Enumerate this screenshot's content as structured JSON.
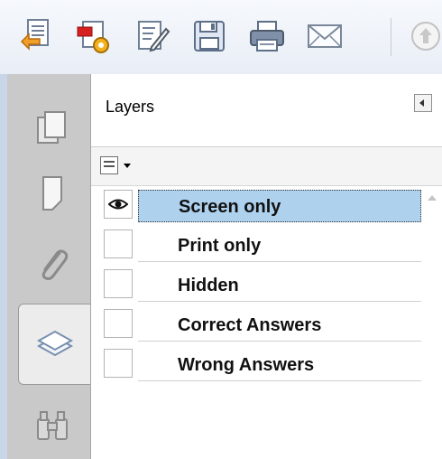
{
  "toolbar": {
    "buttons": [
      {
        "icon": "create-pdf-icon"
      },
      {
        "icon": "settings-document-icon"
      },
      {
        "icon": "edit-document-icon"
      },
      {
        "icon": "save-icon"
      },
      {
        "icon": "print-icon"
      },
      {
        "icon": "email-icon"
      },
      {
        "icon": "upload-icon"
      }
    ]
  },
  "nav_rail": {
    "items": [
      {
        "icon": "pages-icon",
        "active": false
      },
      {
        "icon": "bookmark-icon",
        "active": false
      },
      {
        "icon": "attachment-icon",
        "active": false
      },
      {
        "icon": "layers-icon",
        "active": true
      },
      {
        "icon": "binoculars-icon",
        "active": false
      }
    ]
  },
  "layers_panel": {
    "title": "Layers",
    "layers": [
      {
        "name": "Screen only",
        "visible": true,
        "selected": true
      },
      {
        "name": "Print only",
        "visible": false,
        "selected": false
      },
      {
        "name": "Hidden",
        "visible": false,
        "selected": false
      },
      {
        "name": "Correct Answers",
        "visible": false,
        "selected": false
      },
      {
        "name": "Wrong Answers",
        "visible": false,
        "selected": false
      }
    ]
  },
  "colors": {
    "selection": "#aed1ee",
    "rail": "#c9c9c9",
    "frame": "#c8d6e8"
  }
}
